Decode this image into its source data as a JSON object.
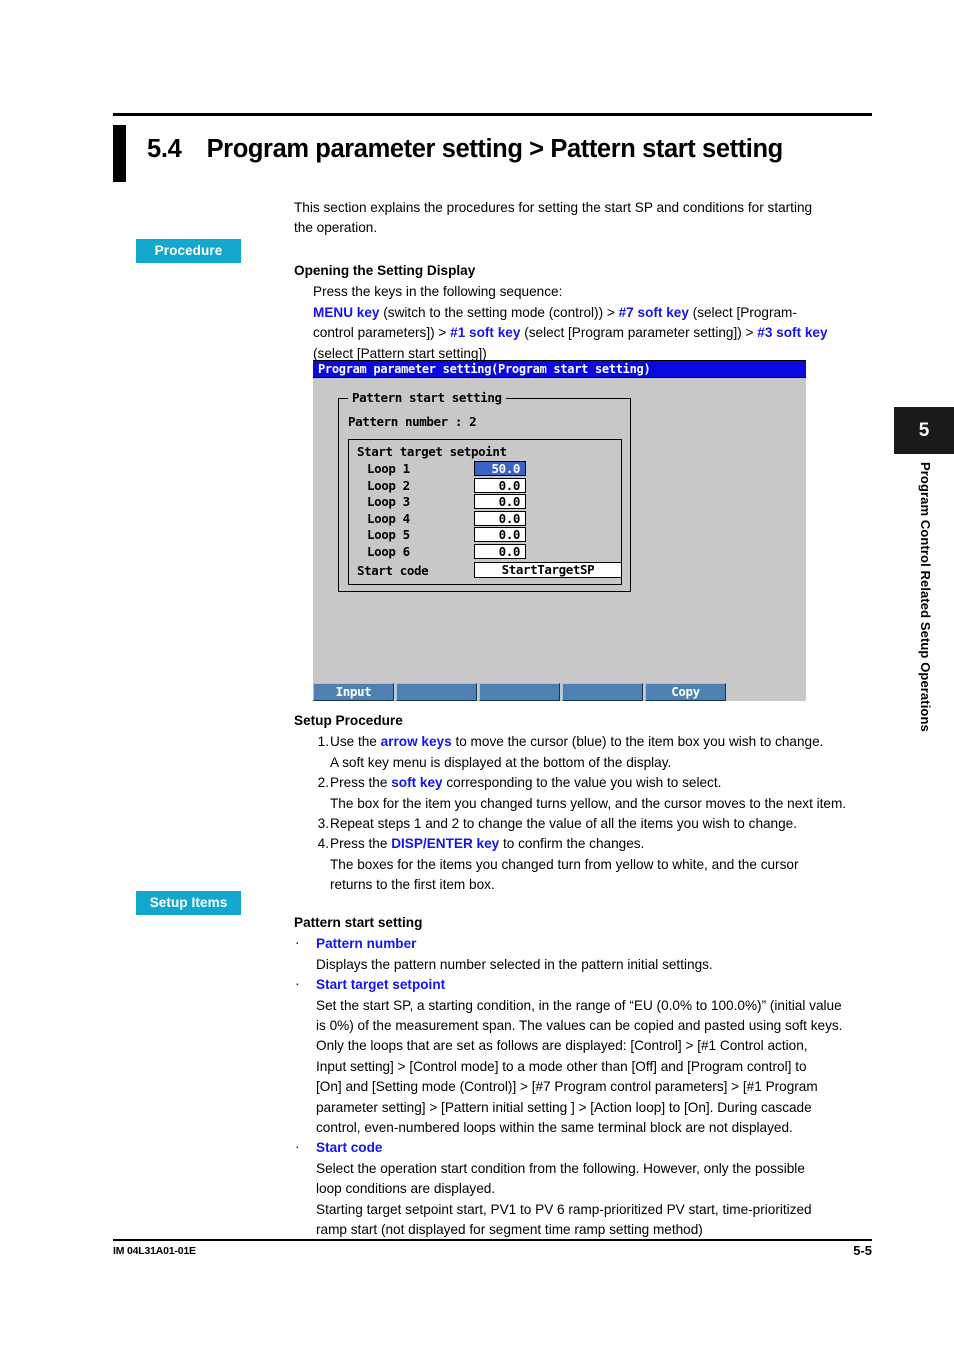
{
  "section": {
    "number": "5.4",
    "title": "Program parameter setting > Pattern start setting"
  },
  "badges": {
    "procedure": "Procedure",
    "setup_items": "Setup Items",
    "color": "#14a7cd"
  },
  "intro": {
    "line1": "This section explains the procedures for setting the start SP and conditions for starting",
    "line2": "the operation."
  },
  "opening": {
    "heading": "Opening the Setting Display",
    "lead": "Press the keys in the following sequence:",
    "seq": {
      "k1": "MENU key",
      "t1": " (switch to the setting mode (control)) > ",
      "k2": "#7 soft key",
      "t2": " (select [Program-",
      "t3": "control parameters]) > ",
      "k3": "#1 soft key",
      "t4": " (select [Program parameter setting]) > ",
      "k4": "#3 soft key",
      "t5": "(select [Pattern start setting])"
    }
  },
  "device": {
    "titlebar": "Program parameter setting(Program start setting)",
    "group_legend": "Pattern start setting",
    "pattern_number": "Pattern number :  2",
    "inner_title": "Start target setpoint",
    "loops": [
      {
        "label": "Loop 1",
        "value": "50.0",
        "selected": true
      },
      {
        "label": "Loop 2",
        "value": "0.0",
        "selected": false
      },
      {
        "label": "Loop 3",
        "value": "0.0",
        "selected": false
      },
      {
        "label": "Loop 4",
        "value": "0.0",
        "selected": false
      },
      {
        "label": "Loop 5",
        "value": "0.0",
        "selected": false
      },
      {
        "label": "Loop 6",
        "value": "0.0",
        "selected": false
      }
    ],
    "start_code_label": "Start code",
    "start_code_value": "StartTargetSP",
    "softkeys": [
      "Input",
      "",
      "",
      "",
      "Copy"
    ],
    "colors": {
      "titlebar": "#0a0ae0",
      "background": "#c8c8c8",
      "selected_cell": "#3a63c8",
      "softkey": "#4d82b0"
    }
  },
  "setup_procedure": {
    "heading": "Setup Procedure",
    "steps": [
      {
        "num": "1.",
        "main_a": "Use the ",
        "main_key": "arrow keys",
        "main_b": " to move the cursor (blue) to the item box you wish to change.",
        "sub": "A soft key menu is displayed at the bottom of the display."
      },
      {
        "num": "2.",
        "main_a": "Press the ",
        "main_key": "soft key",
        "main_b": " corresponding to the value you wish to select.",
        "sub": "The box for the item you changed turns yellow, and the cursor moves to the next item."
      },
      {
        "num": "3.",
        "main_a": "Repeat steps 1 and 2 to change the value of all the items you wish to change.",
        "main_key": "",
        "main_b": "",
        "sub": ""
      },
      {
        "num": "4.",
        "main_a": "Press the ",
        "main_key": "DISP/ENTER key",
        "main_b": " to confirm the changes.",
        "sub": "The boxes for the items you changed turn from yellow to white, and the cursor",
        "sub2": "returns to the first item box."
      }
    ]
  },
  "setup_items": {
    "heading": "Pattern start setting",
    "bullet": "·",
    "items": [
      {
        "label": "Pattern number",
        "lines": [
          "Displays the pattern number selected in the pattern initial settings."
        ]
      },
      {
        "label": "Start target setpoint",
        "lines": [
          "Set the start SP, a starting condition, in the range of “EU (0.0% to 100.0%)” (initial value",
          "is 0%) of the measurement span.  The values can be copied and pasted using soft keys.",
          "Only the loops that are set as follows are displayed: [Control] > [#1 Control action,",
          "Input setting] > [Control mode] to a mode other than [Off] and [Program control] to",
          "[On] and [Setting mode (Control)] > [#7 Program control parameters] > [#1 Program",
          "parameter setting] > [Pattern initial setting ] > [Action loop] to [On].  During cascade",
          "control, even-numbered loops within the same terminal block are not displayed."
        ]
      },
      {
        "label": "Start code",
        "lines": [
          "Select the operation start condition from the following.  However, only the possible",
          "loop conditions are displayed.",
          "Starting target setpoint start, PV1 to PV 6 ramp-prioritized PV start, time-prioritized",
          "ramp start (not displayed for segment time ramp setting method)"
        ]
      }
    ]
  },
  "chapter_tab": {
    "number": "5",
    "label": "Program Control Related Setup Operations"
  },
  "footer": {
    "left": "IM 04L31A01-01E",
    "right": "5-5"
  }
}
